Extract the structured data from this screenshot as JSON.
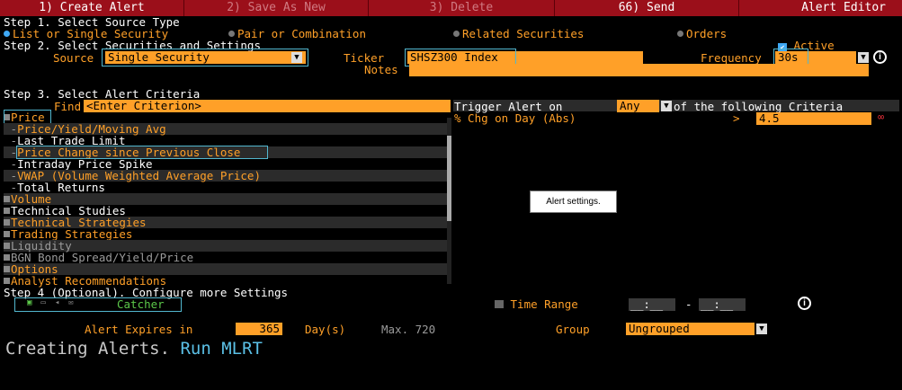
{
  "tabs": [
    {
      "label": "1) Create Alert"
    },
    {
      "label": "2) Save As New"
    },
    {
      "label": "3) Delete"
    },
    {
      "label": "66) Send"
    },
    {
      "label": "Alert Editor"
    }
  ],
  "step1": {
    "title": "Step 1. Select Source Type",
    "options": [
      {
        "label": "List or Single Security",
        "selected": true
      },
      {
        "label": "Pair or Combination",
        "selected": false
      },
      {
        "label": "Related Securities",
        "selected": false
      },
      {
        "label": "Orders",
        "selected": false
      }
    ]
  },
  "step2": {
    "title": "Step 2. Select Securities and Settings",
    "active_label": "Active",
    "source_label": "Source",
    "source_value": "Single Security",
    "ticker_label": "Ticker",
    "ticker_value": "SHSZ300 Index",
    "frequency_label": "Frequency",
    "frequency_value": "30s",
    "notes_label": "Notes"
  },
  "step3": {
    "title": "Step 3. Select Alert Criteria",
    "find_label": "Find",
    "find_placeholder": "<Enter Criterion>",
    "tree": [
      {
        "label": "Price",
        "kind": "group",
        "expanded": true
      },
      {
        "label": "Price/Yield/Moving Avg",
        "kind": "child"
      },
      {
        "label": "Last Trade Limit",
        "kind": "child"
      },
      {
        "label": "Price Change since Previous Close",
        "kind": "child"
      },
      {
        "label": "Intraday Price Spike",
        "kind": "child"
      },
      {
        "label": "VWAP (Volume Weighted Average Price)",
        "kind": "child"
      },
      {
        "label": "Total Returns",
        "kind": "child"
      },
      {
        "label": "Volume",
        "kind": "group"
      },
      {
        "label": "Technical Studies",
        "kind": "group"
      },
      {
        "label": "Technical Strategies",
        "kind": "group"
      },
      {
        "label": "Trading Strategies",
        "kind": "group"
      },
      {
        "label": "Liquidity",
        "kind": "group"
      },
      {
        "label": "BGN Bond Spread/Yield/Price",
        "kind": "group"
      },
      {
        "label": "Options",
        "kind": "group"
      },
      {
        "label": "Analyst Recommendations",
        "kind": "group"
      }
    ],
    "trigger_label": "Trigger Alert on",
    "trigger_value": "Any",
    "trigger_suffix": "of the following Criteria",
    "criterion": {
      "name": "% Chg on Day (Abs)",
      "operator": ">",
      "value": "4.5"
    },
    "tooltip": "Alert settings."
  },
  "step4": {
    "title": "Step 4 (Optional). Configure more Settings",
    "catcher_label": "Catcher",
    "time_range_label": "Time Range",
    "time_from": "__:__",
    "time_dash": "-",
    "time_to": "__:__",
    "expires_label": "Alert Expires in",
    "expires_value": "365",
    "expires_unit": "Day(s)",
    "expires_max": "Max. 720",
    "group_label": "Group",
    "group_value": "Ungrouped"
  },
  "footer": {
    "text": "Creating Alerts.",
    "link": "Run MLRT"
  },
  "colors": {
    "tab_bar": "#9b0f1a",
    "accent_orange": "#ffa028",
    "highlight_border": "#52b7cf",
    "link": "#5bc0e6"
  }
}
